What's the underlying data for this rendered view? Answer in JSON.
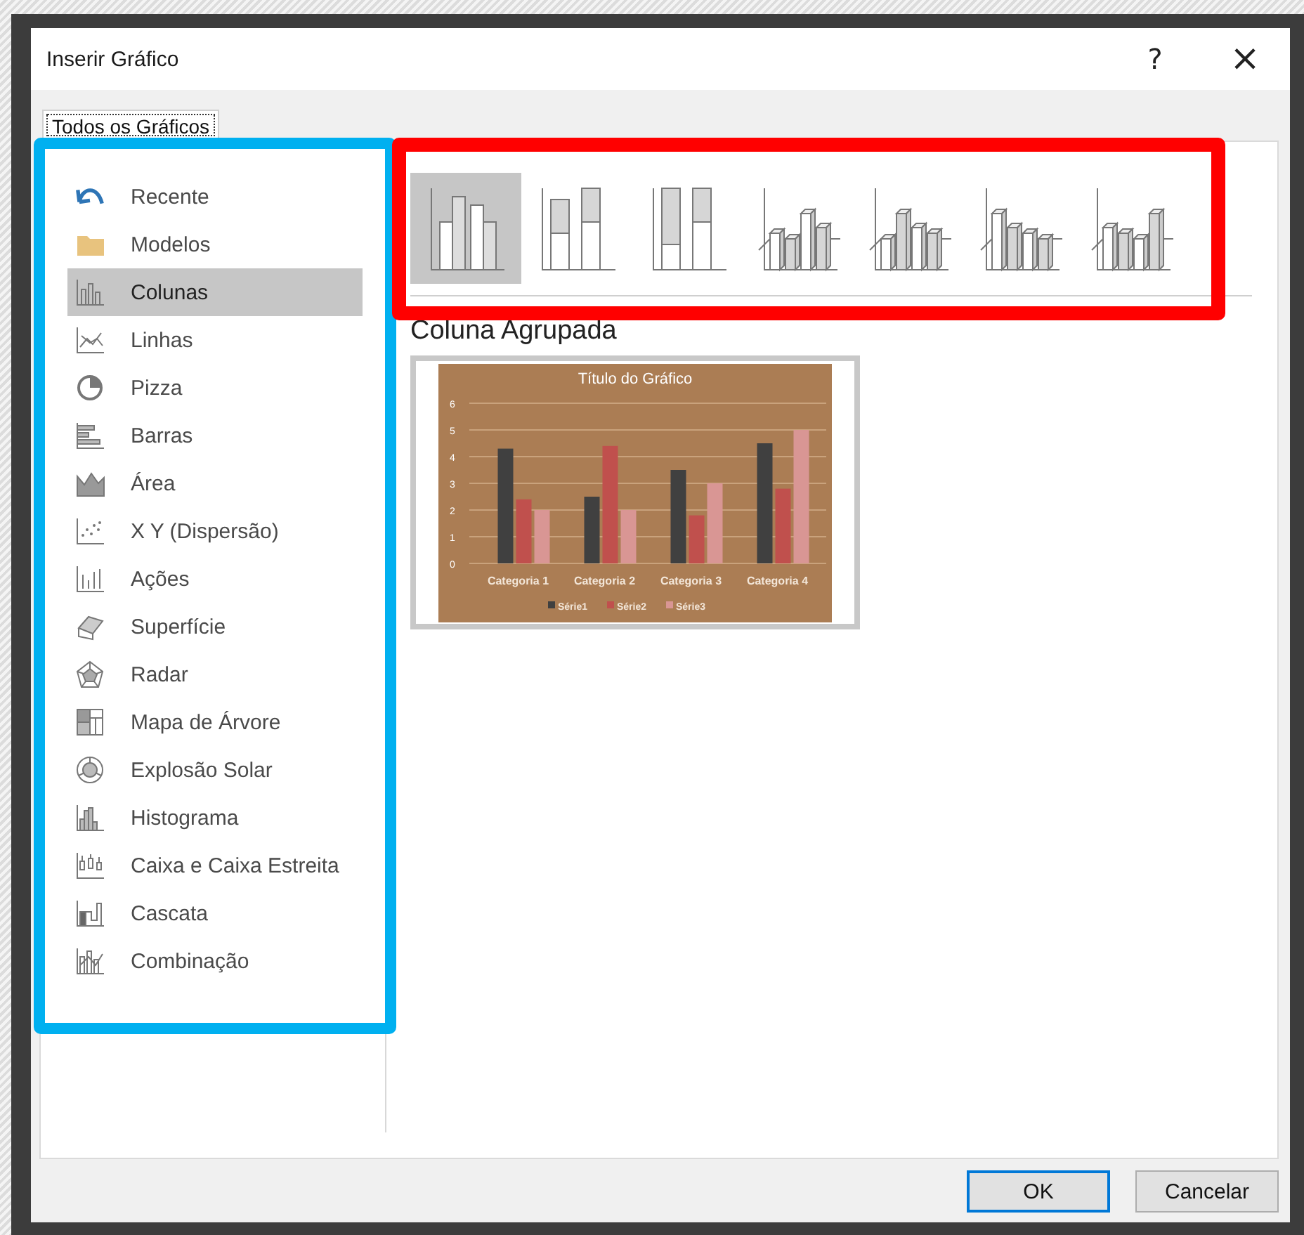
{
  "window": {
    "title": "Inserir Gráfico",
    "help": "?",
    "close": "×"
  },
  "tabs": [
    {
      "label": "Todos os Gráficos",
      "selected": true
    }
  ],
  "categories": [
    {
      "label": "Recente",
      "selected": false
    },
    {
      "label": "Modelos",
      "selected": false
    },
    {
      "label": "Colunas",
      "selected": true
    },
    {
      "label": "Linhas",
      "selected": false
    },
    {
      "label": "Pizza",
      "selected": false
    },
    {
      "label": "Barras",
      "selected": false
    },
    {
      "label": "Área",
      "selected": false
    },
    {
      "label": "X Y (Dispersão)",
      "selected": false
    },
    {
      "label": "Ações",
      "selected": false
    },
    {
      "label": "Superfície",
      "selected": false
    },
    {
      "label": "Radar",
      "selected": false
    },
    {
      "label": "Mapa de Árvore",
      "selected": false
    },
    {
      "label": "Explosão Solar",
      "selected": false
    },
    {
      "label": "Histograma",
      "selected": false
    },
    {
      "label": "Caixa e Caixa Estreita",
      "selected": false
    },
    {
      "label": "Cascata",
      "selected": false
    },
    {
      "label": "Combinação",
      "selected": false
    }
  ],
  "subtypes": [
    {
      "selected": true
    },
    {
      "selected": false
    },
    {
      "selected": false
    },
    {
      "selected": false
    },
    {
      "selected": false
    },
    {
      "selected": false
    },
    {
      "selected": false
    }
  ],
  "preview": {
    "heading": "Coluna Agrupada",
    "chart_data": {
      "type": "bar",
      "title": "Título do Gráfico",
      "categories": [
        "Categoria 1",
        "Categoria 2",
        "Categoria 3",
        "Categoria 4"
      ],
      "series": [
        {
          "name": "Série1",
          "color": "#404040",
          "values": [
            4.3,
            2.5,
            3.5,
            4.5
          ]
        },
        {
          "name": "Série2",
          "color": "#c0504d",
          "values": [
            2.4,
            4.4,
            1.8,
            2.8
          ]
        },
        {
          "name": "Série3",
          "color": "#d99694",
          "values": [
            2,
            2,
            3,
            5
          ]
        }
      ],
      "ylim": [
        0,
        6
      ],
      "yticks": [
        0,
        1,
        2,
        3,
        4,
        5,
        6
      ],
      "grid": true,
      "legend": "bottom"
    }
  },
  "buttons": [
    {
      "label": "OK",
      "default": true
    },
    {
      "label": "Cancelar",
      "default": false
    }
  ]
}
